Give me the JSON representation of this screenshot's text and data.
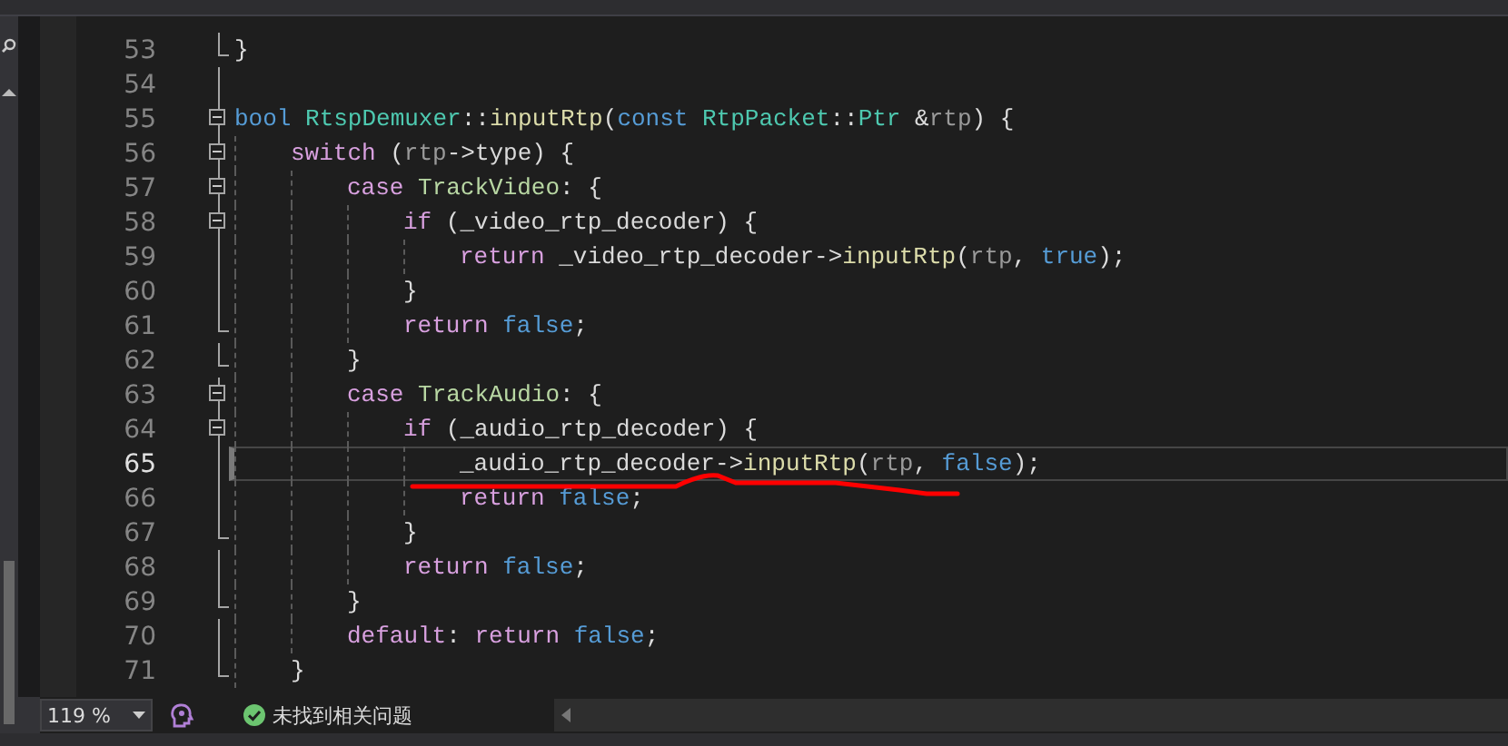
{
  "editor": {
    "lines": [
      {
        "number": "53",
        "fold_toggle": false,
        "block_end": true,
        "current": false,
        "tokens": [
          {
            "text": "}",
            "kind": "plain"
          }
        ]
      },
      {
        "number": "54",
        "fold_toggle": false,
        "block_end": false,
        "current": false
      },
      {
        "number": "55",
        "fold_toggle": true,
        "block_end": false,
        "current": false,
        "tokens": [
          {
            "text": "bool",
            "kind": "keyword"
          },
          {
            "text": " RtspDemuxer",
            "kind": "type"
          },
          {
            "text": "::",
            "kind": "plain"
          },
          {
            "text": "inputRtp",
            "kind": "function"
          },
          {
            "text": "(",
            "kind": "plain"
          },
          {
            "text": "const",
            "kind": "keyword"
          },
          {
            "text": " RtpPacket",
            "kind": "type"
          },
          {
            "text": "::",
            "kind": "plain"
          },
          {
            "text": "Ptr",
            "kind": "type"
          },
          {
            "text": " &",
            "kind": "plain"
          },
          {
            "text": "rtp",
            "kind": "param"
          },
          {
            "text": ") {",
            "kind": "plain"
          }
        ]
      },
      {
        "number": "56",
        "fold_toggle": true,
        "block_end": false,
        "current": false,
        "tokens": [
          {
            "text": "    switch",
            "kind": "control"
          },
          {
            "text": " (",
            "kind": "plain"
          },
          {
            "text": "rtp",
            "kind": "param"
          },
          {
            "text": "->",
            "kind": "plain"
          },
          {
            "text": "type",
            "kind": "member"
          },
          {
            "text": ") {",
            "kind": "plain"
          }
        ]
      },
      {
        "number": "57",
        "fold_toggle": true,
        "block_end": false,
        "current": false,
        "tokens": [
          {
            "text": "        case",
            "kind": "control"
          },
          {
            "text": " TrackVideo",
            "kind": "enum"
          },
          {
            "text": ": {",
            "kind": "plain"
          }
        ]
      },
      {
        "number": "58",
        "fold_toggle": true,
        "block_end": false,
        "current": false,
        "tokens": [
          {
            "text": "            if",
            "kind": "control"
          },
          {
            "text": " (",
            "kind": "plain"
          },
          {
            "text": "_video_rtp_decoder",
            "kind": "member"
          },
          {
            "text": ") {",
            "kind": "plain"
          }
        ]
      },
      {
        "number": "59",
        "fold_toggle": false,
        "block_end": false,
        "current": false,
        "tokens": [
          {
            "text": "                return",
            "kind": "control"
          },
          {
            "text": " _video_rtp_decoder",
            "kind": "member"
          },
          {
            "text": "->",
            "kind": "plain"
          },
          {
            "text": "inputRtp",
            "kind": "function"
          },
          {
            "text": "(",
            "kind": "plain"
          },
          {
            "text": "rtp",
            "kind": "param"
          },
          {
            "text": ", ",
            "kind": "plain"
          },
          {
            "text": "true",
            "kind": "keyword"
          },
          {
            "text": ");",
            "kind": "plain"
          }
        ]
      },
      {
        "number": "60",
        "fold_toggle": false,
        "block_end": false,
        "current": false,
        "tokens": [
          {
            "text": "            }",
            "kind": "plain"
          }
        ]
      },
      {
        "number": "61",
        "fold_toggle": false,
        "block_end": true,
        "current": false,
        "tokens": [
          {
            "text": "            return",
            "kind": "control"
          },
          {
            "text": " false",
            "kind": "keyword"
          },
          {
            "text": ";",
            "kind": "plain"
          }
        ]
      },
      {
        "number": "62",
        "fold_toggle": false,
        "block_end": true,
        "current": false,
        "tokens": [
          {
            "text": "        }",
            "kind": "plain"
          }
        ]
      },
      {
        "number": "63",
        "fold_toggle": true,
        "block_end": false,
        "current": false,
        "tokens": [
          {
            "text": "        case",
            "kind": "control"
          },
          {
            "text": " TrackAudio",
            "kind": "enum"
          },
          {
            "text": ": {",
            "kind": "plain"
          }
        ]
      },
      {
        "number": "64",
        "fold_toggle": true,
        "block_end": false,
        "current": false,
        "tokens": [
          {
            "text": "            if",
            "kind": "control"
          },
          {
            "text": " (",
            "kind": "plain"
          },
          {
            "text": "_audio_rtp_decoder",
            "kind": "member"
          },
          {
            "text": ") {",
            "kind": "plain"
          }
        ]
      },
      {
        "number": "65",
        "fold_toggle": false,
        "block_end": false,
        "current": true,
        "tokens": [
          {
            "text": "                _audio_rtp_decoder",
            "kind": "member"
          },
          {
            "text": "->",
            "kind": "plain"
          },
          {
            "text": "inputRtp",
            "kind": "function"
          },
          {
            "text": "(",
            "kind": "plain"
          },
          {
            "text": "rtp",
            "kind": "param"
          },
          {
            "text": ", ",
            "kind": "plain"
          },
          {
            "text": "false",
            "kind": "keyword"
          },
          {
            "text": ");",
            "kind": "plain"
          }
        ]
      },
      {
        "number": "66",
        "fold_toggle": false,
        "block_end": false,
        "current": false,
        "tokens": [
          {
            "text": "                return",
            "kind": "control"
          },
          {
            "text": " false",
            "kind": "keyword"
          },
          {
            "text": ";",
            "kind": "plain"
          }
        ]
      },
      {
        "number": "67",
        "fold_toggle": false,
        "block_end": true,
        "current": false,
        "tokens": [
          {
            "text": "            }",
            "kind": "plain"
          }
        ]
      },
      {
        "number": "68",
        "fold_toggle": false,
        "block_end": false,
        "current": false,
        "tokens": [
          {
            "text": "            return",
            "kind": "control"
          },
          {
            "text": " false",
            "kind": "keyword"
          },
          {
            "text": ";",
            "kind": "plain"
          }
        ]
      },
      {
        "number": "69",
        "fold_toggle": false,
        "block_end": true,
        "current": false,
        "tokens": [
          {
            "text": "        }",
            "kind": "plain"
          }
        ]
      },
      {
        "number": "70",
        "fold_toggle": false,
        "block_end": false,
        "current": false,
        "tokens": [
          {
            "text": "        default",
            "kind": "control"
          },
          {
            "text": ": ",
            "kind": "plain"
          },
          {
            "text": "return",
            "kind": "control"
          },
          {
            "text": " false",
            "kind": "keyword"
          },
          {
            "text": ";",
            "kind": "plain"
          }
        ]
      },
      {
        "number": "71",
        "fold_toggle": false,
        "block_end": true,
        "current": false,
        "tokens": [
          {
            "text": "    }",
            "kind": "plain"
          }
        ]
      }
    ]
  },
  "status_bar": {
    "zoom": "119 %",
    "issues": "未找到相关问题"
  }
}
